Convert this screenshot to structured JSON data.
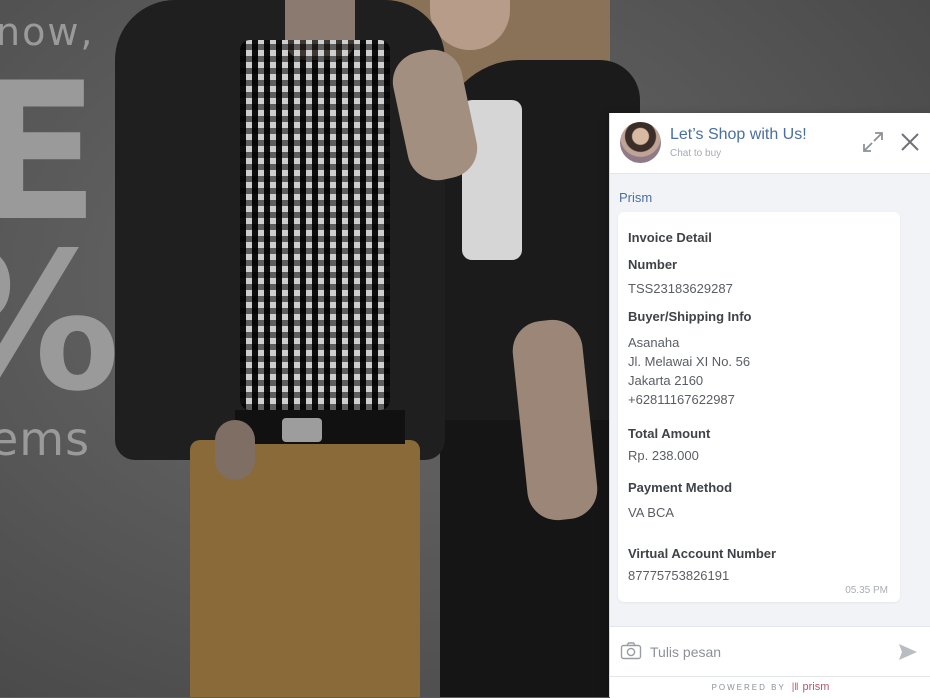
{
  "hero": {
    "line_now": "now,",
    "line_big": "E",
    "line_pct": "%",
    "line_items": "ems"
  },
  "chat": {
    "header": {
      "title": "Let’s Shop with Us!",
      "subtitle": "Chat to buy",
      "expand_icon": "expand-icon",
      "close_icon": "close-icon"
    },
    "sender": "Prism",
    "invoice": {
      "heading": "Invoice Detail",
      "number_label": "Number",
      "number_value": "TSS23183629287",
      "buyer_label": "Buyer/Shipping Info",
      "buyer_lines": [
        "Asanaha",
        "Jl. Melawai XI No. 56",
        "Jakarta 2160",
        "+62811167622987"
      ],
      "total_label": "Total Amount",
      "total_value": "Rp. 238.000",
      "payment_label": "Payment Method",
      "payment_value": "VA BCA",
      "va_label": "Virtual Account Number",
      "va_value": "87775753826191",
      "time": "05.35 PM"
    },
    "composer": {
      "placeholder": "Tulis pesan",
      "value": ""
    },
    "footer": {
      "powered_by": "POWERED BY",
      "brand": "prism"
    }
  },
  "colors": {
    "accent": "#4a6fa1",
    "footer_brand": "#b05a6e"
  }
}
